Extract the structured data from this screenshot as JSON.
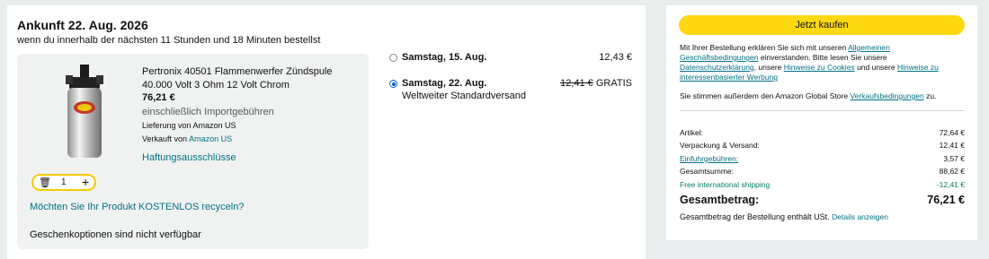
{
  "arrival": {
    "title": "Ankunft 22. Aug. 2026",
    "subtitle": "wenn du innerhalb der nächsten 11 Stunden und 18 Minuten bestellst"
  },
  "product": {
    "title": "Pertronix 40501 Flammenwerfer Zündspule 40.000 Volt 3 Ohm 12 Volt Chrom",
    "price": "76,21 €",
    "import_fees": "einschließlich Importgebühren",
    "delivery": "Lieferung von Amazon US",
    "sold_by_label": "Verkauft von",
    "sold_by_link": "Amazon US",
    "liability": "Haftungsausschlüsse",
    "quantity": "1",
    "icons": {
      "delete": "trash-icon",
      "increase": "plus-icon"
    },
    "recycle": "Möchten Sie Ihr Produkt KOSTENLOS recyceln?",
    "gift": "Geschenkoptionen sind nicht verfügbar"
  },
  "shipping_options": [
    {
      "date": "Samstag, 15. Aug.",
      "price": "12,43 €",
      "selected": false
    },
    {
      "date": "Samstag, 22. Aug.",
      "price": "12,41 €",
      "free": "GRATIS",
      "method": "Weltweiter Standardversand",
      "selected": true
    }
  ],
  "summary": {
    "buy_button": "Jetzt kaufen",
    "legal_1": "Mit Ihrer Bestellung erklären Sie sich mit unseren",
    "legal_link_1": "Allgemeinen Geschäftsbedingungen",
    "legal_2": "einverstanden. Bitte lesen Sie unsere",
    "legal_link_2": "Datenschutzerklärung",
    "legal_3": ", unsere",
    "legal_link_3": "Hinweise zu Cookies",
    "legal_4": "und unsere",
    "legal_link_4": "Hinweise zu interessenbasierter Werbung",
    "store_1": "Sie stimmen außerdem den Amazon Global Store",
    "store_link": "Verkaufsbedingungen",
    "store_2": "zu.",
    "rows": [
      {
        "label": "Artikel:",
        "value": "72,64 €"
      },
      {
        "label": "Verpackung & Versand:",
        "value": "12,41 €"
      },
      {
        "label": "Einfuhrgebühren:",
        "value": "3,57 €"
      },
      {
        "label": "Gesamtsumme:",
        "value": "88,62 €"
      },
      {
        "label": "Free international shipping",
        "value": "-12,41 €"
      }
    ],
    "total_label": "Gesamtbetrag:",
    "total_value": "76,21 €",
    "tax_note": "Gesamtbetrag der Bestellung enthält USt.",
    "tax_link": "Details anzeigen"
  },
  "colors": {
    "buy": "#ffd814",
    "link": "#007185",
    "green": "#067d62",
    "select": "#0a63c9"
  }
}
